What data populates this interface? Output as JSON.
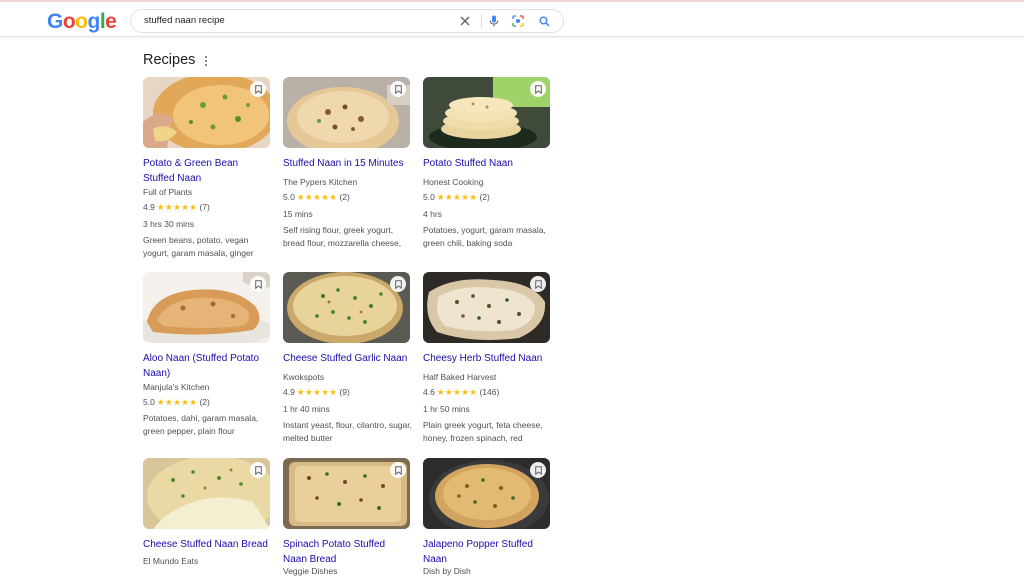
{
  "search": {
    "query": "stuffed naan recipe"
  },
  "section": {
    "title": "Recipes"
  },
  "colors": {
    "link": "#1a0dab",
    "star": "#fbbc04",
    "text": "#4d5156"
  },
  "icons": [
    "clear-icon",
    "mic-icon",
    "lens-icon",
    "search-icon",
    "bookmark-icon",
    "more-vert-icon"
  ],
  "recipes": [
    {
      "title": "Potato & Green Bean Stuffed Naan",
      "source": "Full of Plants",
      "rating": "4.9",
      "stars": "★★★★★",
      "reviews": "(7)",
      "time": "3 hrs 30 mins",
      "ingredients": "Green beans, potato, vegan yogurt, garam masala, ginger"
    },
    {
      "title": "Stuffed Naan in 15 Minutes",
      "source": "The Pypers Kitchen",
      "rating": "5.0",
      "stars": "★★★★★",
      "reviews": "(2)",
      "time": "15 mins",
      "ingredients": "Self rising flour, greek yogurt, bread flour, mozzarella cheese,"
    },
    {
      "title": "Potato Stuffed Naan",
      "source": "Honest Cooking",
      "rating": "5.0",
      "stars": "★★★★★",
      "reviews": "(2)",
      "time": "4 hrs",
      "ingredients": "Potatoes, yogurt, garam masala, green chili, baking soda"
    },
    {
      "title": "Aloo Naan (Stuffed Potato Naan)",
      "source": "Manjula's Kitchen",
      "rating": "5.0",
      "stars": "★★★★★",
      "reviews": "(2)",
      "time": "",
      "ingredients": "Potatoes, dahi, garam masala, green pepper, plain flour"
    },
    {
      "title": "Cheese Stuffed Garlic Naan",
      "source": "Kwokspots",
      "rating": "4.9",
      "stars": "★★★★★",
      "reviews": "(9)",
      "time": "1 hr 40 mins",
      "ingredients": "Instant yeast, flour, cilantro, sugar, melted butter"
    },
    {
      "title": "Cheesy Herb Stuffed Naan",
      "source": "Half Baked Harvest",
      "rating": "4.6",
      "stars": "★★★★★",
      "reviews": "(146)",
      "time": "1 hr 50 mins",
      "ingredients": "Plain greek yogurt, feta cheese, honey, frozen spinach, red"
    },
    {
      "title": "Cheese Stuffed Naan Bread",
      "source": "El Mundo Eats",
      "rating": "",
      "stars": "",
      "reviews": "",
      "time": "",
      "ingredients": ""
    },
    {
      "title": "Spinach Potato Stuffed Naan Bread",
      "source": "Veggie Dishes",
      "rating": "",
      "stars": "",
      "reviews": "",
      "time": "",
      "ingredients": ""
    },
    {
      "title": "Jalapeno Popper Stuffed Naan",
      "source": "Dish by Dish",
      "rating": "",
      "stars": "",
      "reviews": "",
      "time": "",
      "ingredients": ""
    }
  ]
}
